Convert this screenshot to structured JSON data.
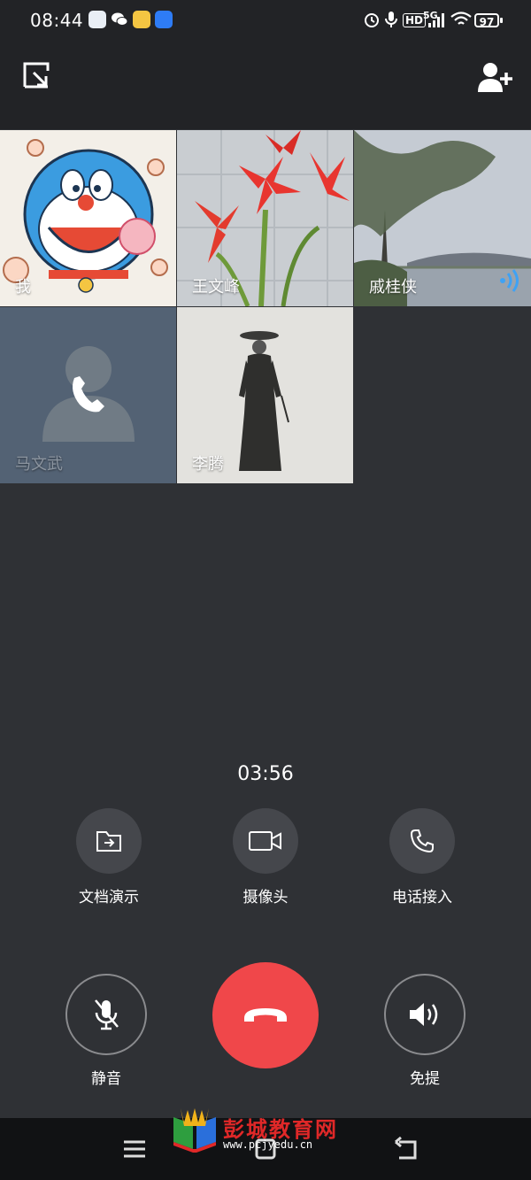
{
  "status_bar": {
    "time": "08:44",
    "battery": "97",
    "network": "5G",
    "hd": "HD"
  },
  "participants": [
    {
      "name": "我",
      "avatar": "cartoon-cat"
    },
    {
      "name": "王文峰",
      "avatar": "red-flowers"
    },
    {
      "name": "戚桂侠",
      "avatar": "lake-tree",
      "speaking": true
    },
    {
      "name": "马文武",
      "avatar": "placeholder-calling"
    },
    {
      "name": "李腾",
      "avatar": "ink-figure"
    }
  ],
  "call": {
    "duration": "03:56",
    "controls": [
      {
        "label": "文档演示",
        "icon": "share-document-icon"
      },
      {
        "label": "摄像头",
        "icon": "camera-icon"
      },
      {
        "label": "电话接入",
        "icon": "phone-icon"
      }
    ],
    "mute_label": "静音",
    "speaker_label": "免提"
  },
  "watermark": {
    "title": "彭城教育网",
    "url": "www.pcjyedu.cn"
  },
  "colors": {
    "hangup": "#f0474a",
    "background": "#2f3135",
    "speaking": "#3ea2f5"
  }
}
